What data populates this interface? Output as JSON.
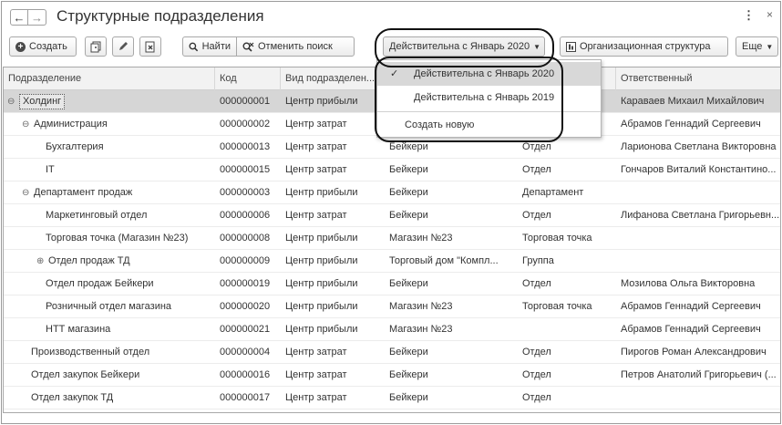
{
  "window": {
    "title": "Структурные подразделения",
    "more_glyph": "⋮",
    "close_glyph": "×"
  },
  "nav": {
    "back_glyph": "←",
    "forward_glyph": "→"
  },
  "toolbar": {
    "create_label": "Создать",
    "find_label": "Найти",
    "cancel_search_label": "Отменить поиск",
    "valid_label": "Действительна с Январь 2020",
    "org_structure_label": "Организационная структура",
    "more_label": "Еще"
  },
  "dropdown": {
    "items": [
      {
        "label": "Действительна с Январь 2020",
        "checked": true
      },
      {
        "label": "Действительна с Январь 2019",
        "checked": false
      },
      {
        "label": "Создать новую",
        "checked": false
      }
    ],
    "check_glyph": "✓"
  },
  "table": {
    "columns": [
      "Подразделение",
      "Код",
      "Вид подразделен...",
      "",
      "",
      "Ответственный"
    ],
    "rows": [
      {
        "name": "Холдинг",
        "code": "000000001",
        "kind": "Центр прибыли",
        "org": "",
        "type": "",
        "resp": "Караваев Михаил Михайлович",
        "level": 0,
        "toggle": "⊖",
        "selected": true
      },
      {
        "name": "Администрация",
        "code": "000000002",
        "kind": "Центр затрат",
        "org": "",
        "type": "",
        "resp": "Абрамов Геннадий Сергеевич",
        "level": 1,
        "toggle": "⊖"
      },
      {
        "name": "Бухгалтерия",
        "code": "000000013",
        "kind": "Центр затрат",
        "org": "Бейкери",
        "type": "Отдел",
        "resp": "Ларионова Светлана Викторовна",
        "level": 2,
        "toggle": ""
      },
      {
        "name": "IT",
        "code": "000000015",
        "kind": "Центр затрат",
        "org": "Бейкери",
        "type": "Отдел",
        "resp": "Гончаров Виталий Константино...",
        "level": 2,
        "toggle": ""
      },
      {
        "name": "Департамент продаж",
        "code": "000000003",
        "kind": "Центр прибыли",
        "org": "Бейкери",
        "type": "Департамент",
        "resp": "",
        "level": 1,
        "toggle": "⊖"
      },
      {
        "name": "Маркетинговый отдел",
        "code": "000000006",
        "kind": "Центр затрат",
        "org": "Бейкери",
        "type": "Отдел",
        "resp": "Лифанова Светлана Григорьевн...",
        "level": 2,
        "toggle": ""
      },
      {
        "name": "Торговая точка (Магазин №23)",
        "code": "000000008",
        "kind": "Центр прибыли",
        "org": "Магазин №23",
        "type": "Торговая точка",
        "resp": "",
        "level": 2,
        "toggle": ""
      },
      {
        "name": "Отдел продаж ТД",
        "code": "000000009",
        "kind": "Центр прибыли",
        "org": "Торговый дом \"Компл...",
        "type": "Группа",
        "resp": "",
        "level": 2,
        "toggle": "⊕",
        "toggle_indent": true
      },
      {
        "name": "Отдел продаж Бейкери",
        "code": "000000019",
        "kind": "Центр прибыли",
        "org": "Бейкери",
        "type": "Отдел",
        "resp": "Мозилова Ольга Викторовна",
        "level": 2,
        "toggle": ""
      },
      {
        "name": "Розничный отдел магазина",
        "code": "000000020",
        "kind": "Центр прибыли",
        "org": "Магазин №23",
        "type": "Торговая точка",
        "resp": "Абрамов Геннадий Сергеевич",
        "level": 2,
        "toggle": ""
      },
      {
        "name": "НТТ магазина",
        "code": "000000021",
        "kind": "Центр прибыли",
        "org": "Магазин №23",
        "type": "",
        "resp": "Абрамов Геннадий Сергеевич",
        "level": 2,
        "toggle": ""
      },
      {
        "name": "Производственный отдел",
        "code": "000000004",
        "kind": "Центр затрат",
        "org": "Бейкери",
        "type": "Отдел",
        "resp": "Пирогов Роман Александрович",
        "level": 1,
        "toggle": ""
      },
      {
        "name": "Отдел закупок Бейкери",
        "code": "000000016",
        "kind": "Центр затрат",
        "org": "Бейкери",
        "type": "Отдел",
        "resp": "Петров Анатолий Григорьевич (...",
        "level": 1,
        "toggle": ""
      },
      {
        "name": "Отдел закупок ТД",
        "code": "000000017",
        "kind": "Центр затрат",
        "org": "Бейкери",
        "type": "Отдел",
        "resp": "",
        "level": 1,
        "toggle": ""
      }
    ]
  }
}
